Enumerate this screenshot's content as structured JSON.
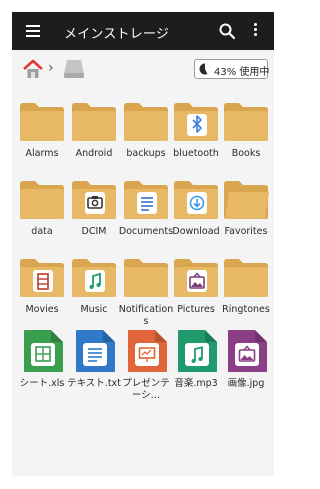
{
  "appbar": {
    "title": "メインストレージ"
  },
  "usage": {
    "text": "43% 使用中",
    "percent": 43
  },
  "colors": {
    "folder": "#e7b865",
    "folder_dark": "#d9a54e",
    "appbar": "#1d1d1d"
  },
  "items": [
    {
      "label": "Alarms",
      "icon": "folder-icon"
    },
    {
      "label": "Android",
      "icon": "folder-icon"
    },
    {
      "label": "backups",
      "icon": "folder-icon"
    },
    {
      "label": "bluetooth",
      "icon": "folder-bluetooth-icon"
    },
    {
      "label": "Books",
      "icon": "folder-icon"
    },
    {
      "label": "data",
      "icon": "folder-icon"
    },
    {
      "label": "DCIM",
      "icon": "folder-camera-icon"
    },
    {
      "label": "Documents",
      "icon": "folder-document-icon"
    },
    {
      "label": "Download",
      "icon": "folder-download-icon"
    },
    {
      "label": "Favorites",
      "icon": "folder-open-icon"
    },
    {
      "label": "Movies",
      "icon": "folder-movie-icon"
    },
    {
      "label": "Music",
      "icon": "folder-music-icon"
    },
    {
      "label": "Notifications",
      "icon": "folder-icon"
    },
    {
      "label": "Pictures",
      "icon": "folder-picture-icon"
    },
    {
      "label": "Ringtones",
      "icon": "folder-icon"
    },
    {
      "label": "シート.xls",
      "icon": "spreadsheet-file-icon"
    },
    {
      "label": "テキスト.txt",
      "icon": "text-file-icon"
    },
    {
      "label": "プレゼンテーシ…",
      "icon": "presentation-file-icon"
    },
    {
      "label": "音楽.mp3",
      "icon": "audio-file-icon"
    },
    {
      "label": "画像.jpg",
      "icon": "image-file-icon"
    }
  ]
}
